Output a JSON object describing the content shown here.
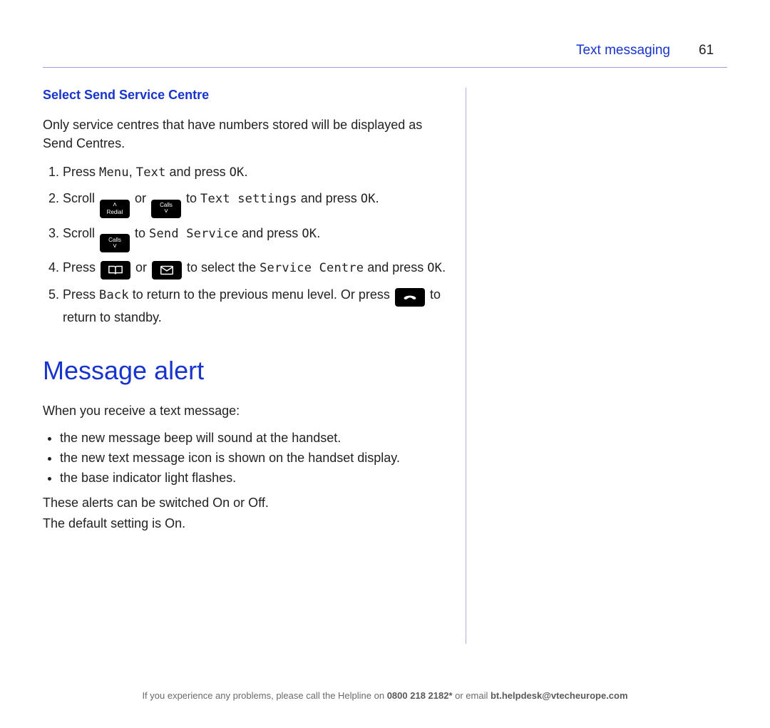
{
  "header": {
    "section": "Text messaging",
    "page": "61"
  },
  "select_send": {
    "heading": "Select Send Service Centre",
    "intro": "Only service centres that have numbers stored will be displayed as Send Centres.",
    "steps": {
      "s1a": "Press ",
      "s1_menu": "Menu",
      "s1b": ", ",
      "s1_text": "Text",
      "s1c": " and press ",
      "s1_ok": "OK",
      "s1d": ".",
      "s2a": "Scroll ",
      "s2_or": " or ",
      "s2b": " to ",
      "s2_target": "Text settings",
      "s2c": " and press ",
      "s2_ok": "OK",
      "s2d": ".",
      "s3a": "Scroll ",
      "s3b": " to ",
      "s3_target": "Send Service",
      "s3c": " and press ",
      "s3_ok": "OK",
      "s3d": ".",
      "s4a": "Press ",
      "s4_or": " or ",
      "s4b": " to select the ",
      "s4_target": "Service Centre",
      "s4c": " and press ",
      "s4_ok": "OK",
      "s4d": ".",
      "s5a": "Press ",
      "s5_back": "Back",
      "s5b": " to return to the previous menu level. Or press ",
      "s5c": " to return to standby."
    },
    "key_labels": {
      "redial_up": "Redial",
      "calls_down": "Calls"
    }
  },
  "message_alert": {
    "heading": "Message alert",
    "intro": "When you receive a text message:",
    "bullets": [
      "the new message beep will sound at the handset.",
      "the new text message icon is shown on the handset display.",
      "the base indicator light flashes."
    ],
    "post1": "These alerts can be switched On or Off.",
    "post2": "The default setting is On."
  },
  "footer": {
    "pre": "If you experience any problems, please call the Helpline on ",
    "phone": "0800 218 2182*",
    "mid": " or email ",
    "email": "bt.helpdesk@vtecheurope.com"
  }
}
